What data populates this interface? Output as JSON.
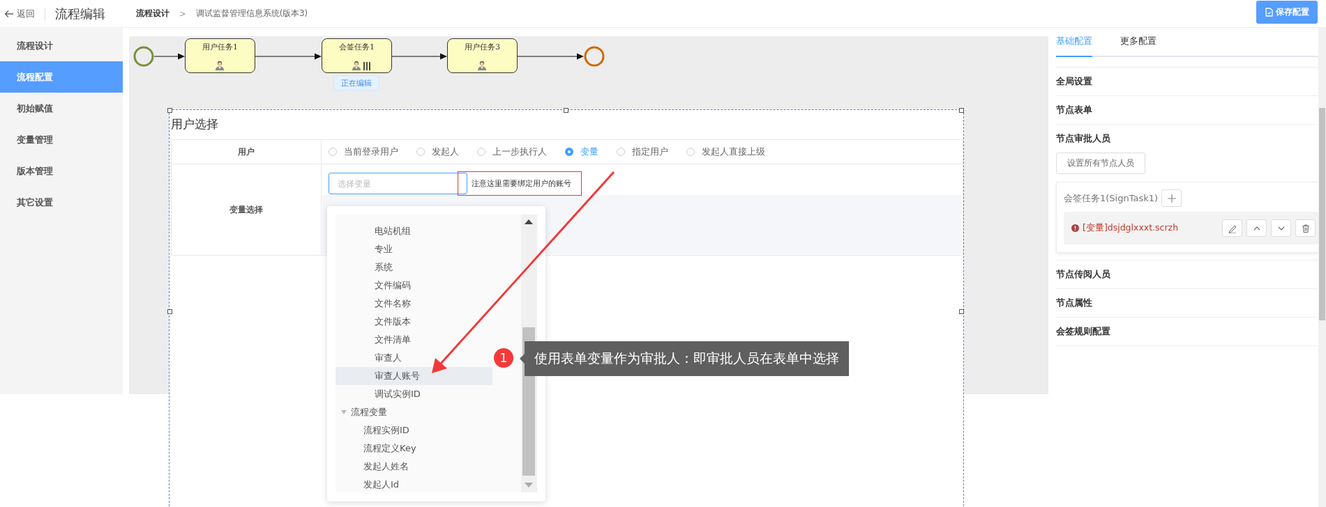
{
  "header": {
    "back": "返回",
    "title": "流程编辑",
    "breadcrumb": [
      "流程设计",
      "调试监督管理信息系统(版本3)"
    ],
    "separator": ">",
    "save_button": "保存配置"
  },
  "sidebar": {
    "items": [
      {
        "label": "流程设计",
        "selected": false
      },
      {
        "label": "流程配置",
        "selected": true
      },
      {
        "label": "初始赋值",
        "selected": false
      },
      {
        "label": "变量管理",
        "selected": false
      },
      {
        "label": "版本管理",
        "selected": false
      },
      {
        "label": "其它设置",
        "selected": false
      }
    ]
  },
  "diagram": {
    "editing_tag": "正在编辑",
    "nodes": [
      {
        "kind": "start"
      },
      {
        "kind": "task",
        "label": "用户任务1",
        "multi": false,
        "selected": false
      },
      {
        "kind": "task",
        "label": "会签任务1",
        "multi": true,
        "selected": true
      },
      {
        "kind": "task",
        "label": "用户任务3",
        "multi": false,
        "selected": false
      },
      {
        "kind": "end"
      }
    ]
  },
  "form": {
    "title": "用户选择",
    "rows": [
      {
        "kind": "radios",
        "label": "用户",
        "options": [
          {
            "label": "当前登录用户",
            "selected": false
          },
          {
            "label": "发起人",
            "selected": false
          },
          {
            "label": "上一步执行人",
            "selected": false
          },
          {
            "label": "变量",
            "selected": true
          },
          {
            "label": "指定用户",
            "selected": false
          },
          {
            "label": "发起人直接上级",
            "selected": false
          }
        ]
      },
      {
        "kind": "variable",
        "label": "变量选择",
        "placeholder": "选择变量",
        "note": "注意这里需要绑定用户的账号"
      }
    ]
  },
  "dropdown": {
    "tree": [
      {
        "children": [
          {
            "label": "电站机组",
            "hovered": false
          },
          {
            "label": "专业",
            "hovered": false
          },
          {
            "label": "系统",
            "hovered": false
          },
          {
            "label": "文件编码",
            "hovered": false
          },
          {
            "label": "文件名称",
            "hovered": false
          },
          {
            "label": "文件版本",
            "hovered": false
          },
          {
            "label": "文件清单",
            "hovered": false
          },
          {
            "label": "审查人",
            "hovered": false
          },
          {
            "label": "审查人账号",
            "hovered": true
          },
          {
            "label": "调试实例ID",
            "hovered": false
          }
        ]
      },
      {
        "label": "流程变量",
        "expanded": true,
        "children": [
          {
            "label": "流程实例ID",
            "hovered": false
          },
          {
            "label": "流程定义Key",
            "hovered": false
          },
          {
            "label": "发起人姓名",
            "hovered": false
          },
          {
            "label": "发起人Id",
            "hovered": false
          }
        ]
      }
    ]
  },
  "annotation": {
    "number": "1",
    "text": "使用表单变量作为审批人：即审批人员在表单中选择"
  },
  "right_panel": {
    "tabs": [
      {
        "label": "基础配置",
        "selected": true
      },
      {
        "label": "更多配置",
        "selected": false
      }
    ],
    "sections": [
      {
        "label": "全局设置",
        "expanded": false
      },
      {
        "label": "节点表单",
        "expanded": false
      },
      {
        "label": "节点审批人员",
        "expanded": true,
        "button": "设置所有节点人员",
        "task": "会签任务1(SignTask1)",
        "assignees": [
          {
            "text": "[变量]dsjdglxxxt.scrzh",
            "error": true
          }
        ]
      },
      {
        "label": "节点传阅人员",
        "expanded": false
      },
      {
        "label": "节点属性",
        "expanded": false
      },
      {
        "label": "会签规则配置",
        "expanded": false
      }
    ]
  }
}
